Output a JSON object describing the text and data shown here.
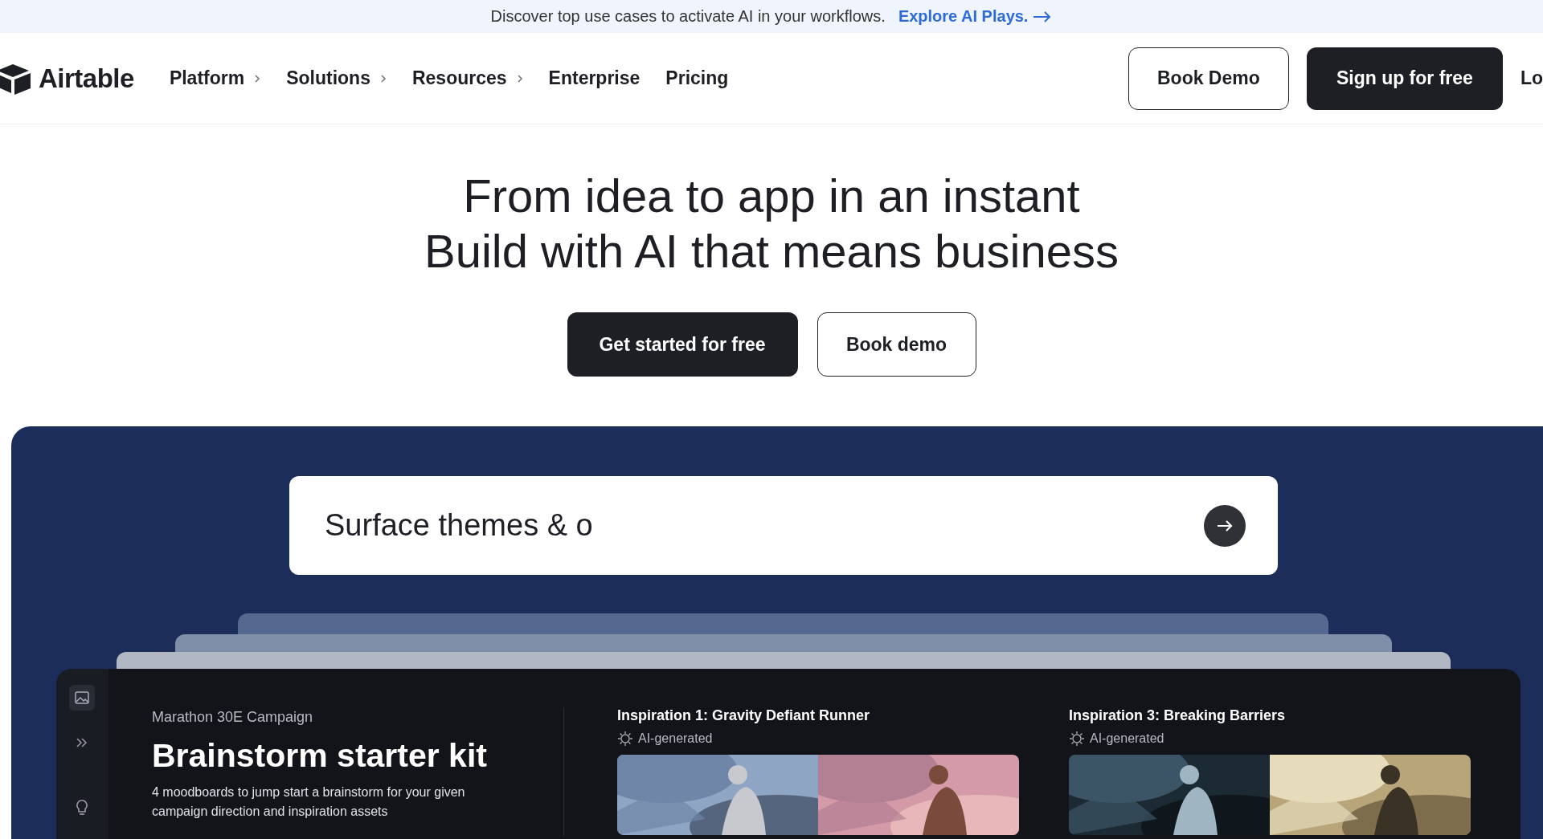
{
  "banner": {
    "text": "Discover top use cases to activate AI in your workflows.",
    "link": "Explore AI Plays."
  },
  "nav": {
    "logo": "Airtable",
    "items": [
      {
        "label": "Platform",
        "has_submenu": true
      },
      {
        "label": "Solutions",
        "has_submenu": true
      },
      {
        "label": "Resources",
        "has_submenu": true
      },
      {
        "label": "Enterprise",
        "has_submenu": false
      },
      {
        "label": "Pricing",
        "has_submenu": false
      }
    ],
    "book_demo": "Book Demo",
    "sign_up": "Sign up for free",
    "login": "Lo"
  },
  "hero": {
    "lines": [
      "From idea to app in an instant",
      "Build with AI that means business"
    ],
    "primary": "Get started for free",
    "secondary": "Book demo"
  },
  "prompt": {
    "value": "Surface themes & o"
  },
  "app": {
    "eyebrow": "Marathon 30E Campaign",
    "title": "Brainstorm starter kit",
    "description": "4 moodboards to jump start a brainstorm for your given campaign direction and inspiration assets",
    "inspirations": [
      {
        "title": "Inspiration 1: Gravity Defiant Runner",
        "tag": "AI-generated"
      },
      {
        "title": "Inspiration 3: Breaking Barriers",
        "tag": "AI-generated"
      }
    ]
  }
}
